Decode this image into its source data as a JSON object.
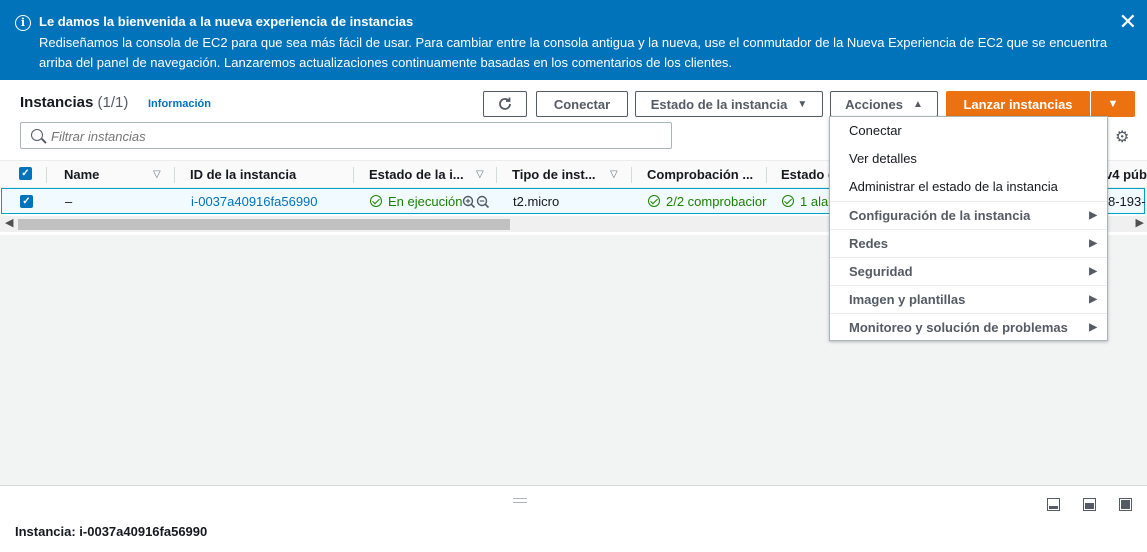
{
  "banner": {
    "title": "Le damos la bienvenida a la nueva experiencia de instancias",
    "body": "Rediseñamos la consola de EC2 para que sea más fácil de usar. Para cambiar entre la consola antigua y la nueva, use el conmutador de la Nueva Experiencia de EC2 que se encuentra arriba del panel de navegación. Lanzaremos actualizaciones continuamente basadas en los comentarios de los clientes.",
    "close_glyph": "✕"
  },
  "header": {
    "title": "Instancias",
    "count": "(1/1)",
    "info_link": "Información",
    "connect_label": "Conectar",
    "state_label": "Estado de la instancia",
    "actions_label": "Acciones",
    "launch_label": "Lanzar instancias"
  },
  "search": {
    "placeholder": "Filtrar instancias"
  },
  "table": {
    "columns": [
      "Name",
      "ID de la instancia",
      "Estado de la i...",
      "Tipo de inst...",
      "Comprobación ...",
      "Estado d",
      "v4 púb"
    ],
    "row": {
      "name": "–",
      "instance_id": "i-0037a40916fa56990",
      "state": "En ejecución",
      "type": "t2.micro",
      "checks": "2/2 comprobacior",
      "alarm": "1 ala",
      "ipv4": "8-193-"
    }
  },
  "menu": {
    "items": [
      "Conectar",
      "Ver detalles",
      "Administrar el estado de la instancia",
      "Configuración de la instancia",
      "Redes",
      "Seguridad",
      "Imagen y plantillas",
      "Monitoreo y solución de problemas"
    ]
  },
  "details": {
    "title": "Instancia: i-0037a40916fa56990"
  },
  "colors": {
    "banner": "#0073bb",
    "primary": "#ec7211",
    "link": "#0073bb",
    "success": "#1d8102"
  },
  "icons": [
    "info-icon",
    "close-icon",
    "refresh-icon",
    "caret-down-icon",
    "caret-up-icon",
    "search-icon",
    "gear-icon",
    "zoom-in-icon",
    "zoom-out-icon",
    "check-circle-icon",
    "chevron-right-icon"
  ]
}
